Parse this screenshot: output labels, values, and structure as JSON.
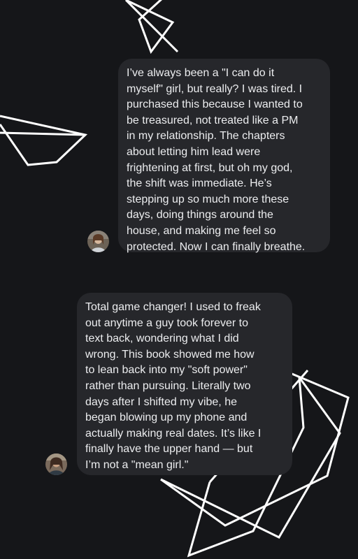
{
  "messages": [
    {
      "id": "review-1",
      "lines": [
        "I’ve always been a \"I can do it",
        "myself\" girl, but really? I was tired. I",
        "purchased this because I wanted to",
        "be treasured, not treated like a PM",
        "in my relationship. The chapters",
        "about letting him lead were",
        "frightening at first, but oh my god,",
        "the shift was immediate. He’s",
        "stepping up so much more these",
        "days, doing things around the",
        "house, and making me feel so",
        "protected. Now I can finally breathe."
      ]
    },
    {
      "id": "review-2",
      "lines": [
        "Total game changer! I used to freak",
        "out anytime a guy took forever to",
        "text back, wondering what I did",
        "wrong. This book showed me how",
        "to lean back into my \"soft power\"",
        "rather than pursuing. Literally two",
        "days after I shifted my vibe, he",
        "began blowing up my phone and",
        "actually making real dates. It’s like I",
        "finally have the upper hand — but",
        "I’m not a \"mean girl.\""
      ]
    }
  ],
  "colors": {
    "background": "#151619",
    "bubble": "#26272b",
    "text": "#ecedef",
    "decor_lines": "#ffffff"
  }
}
